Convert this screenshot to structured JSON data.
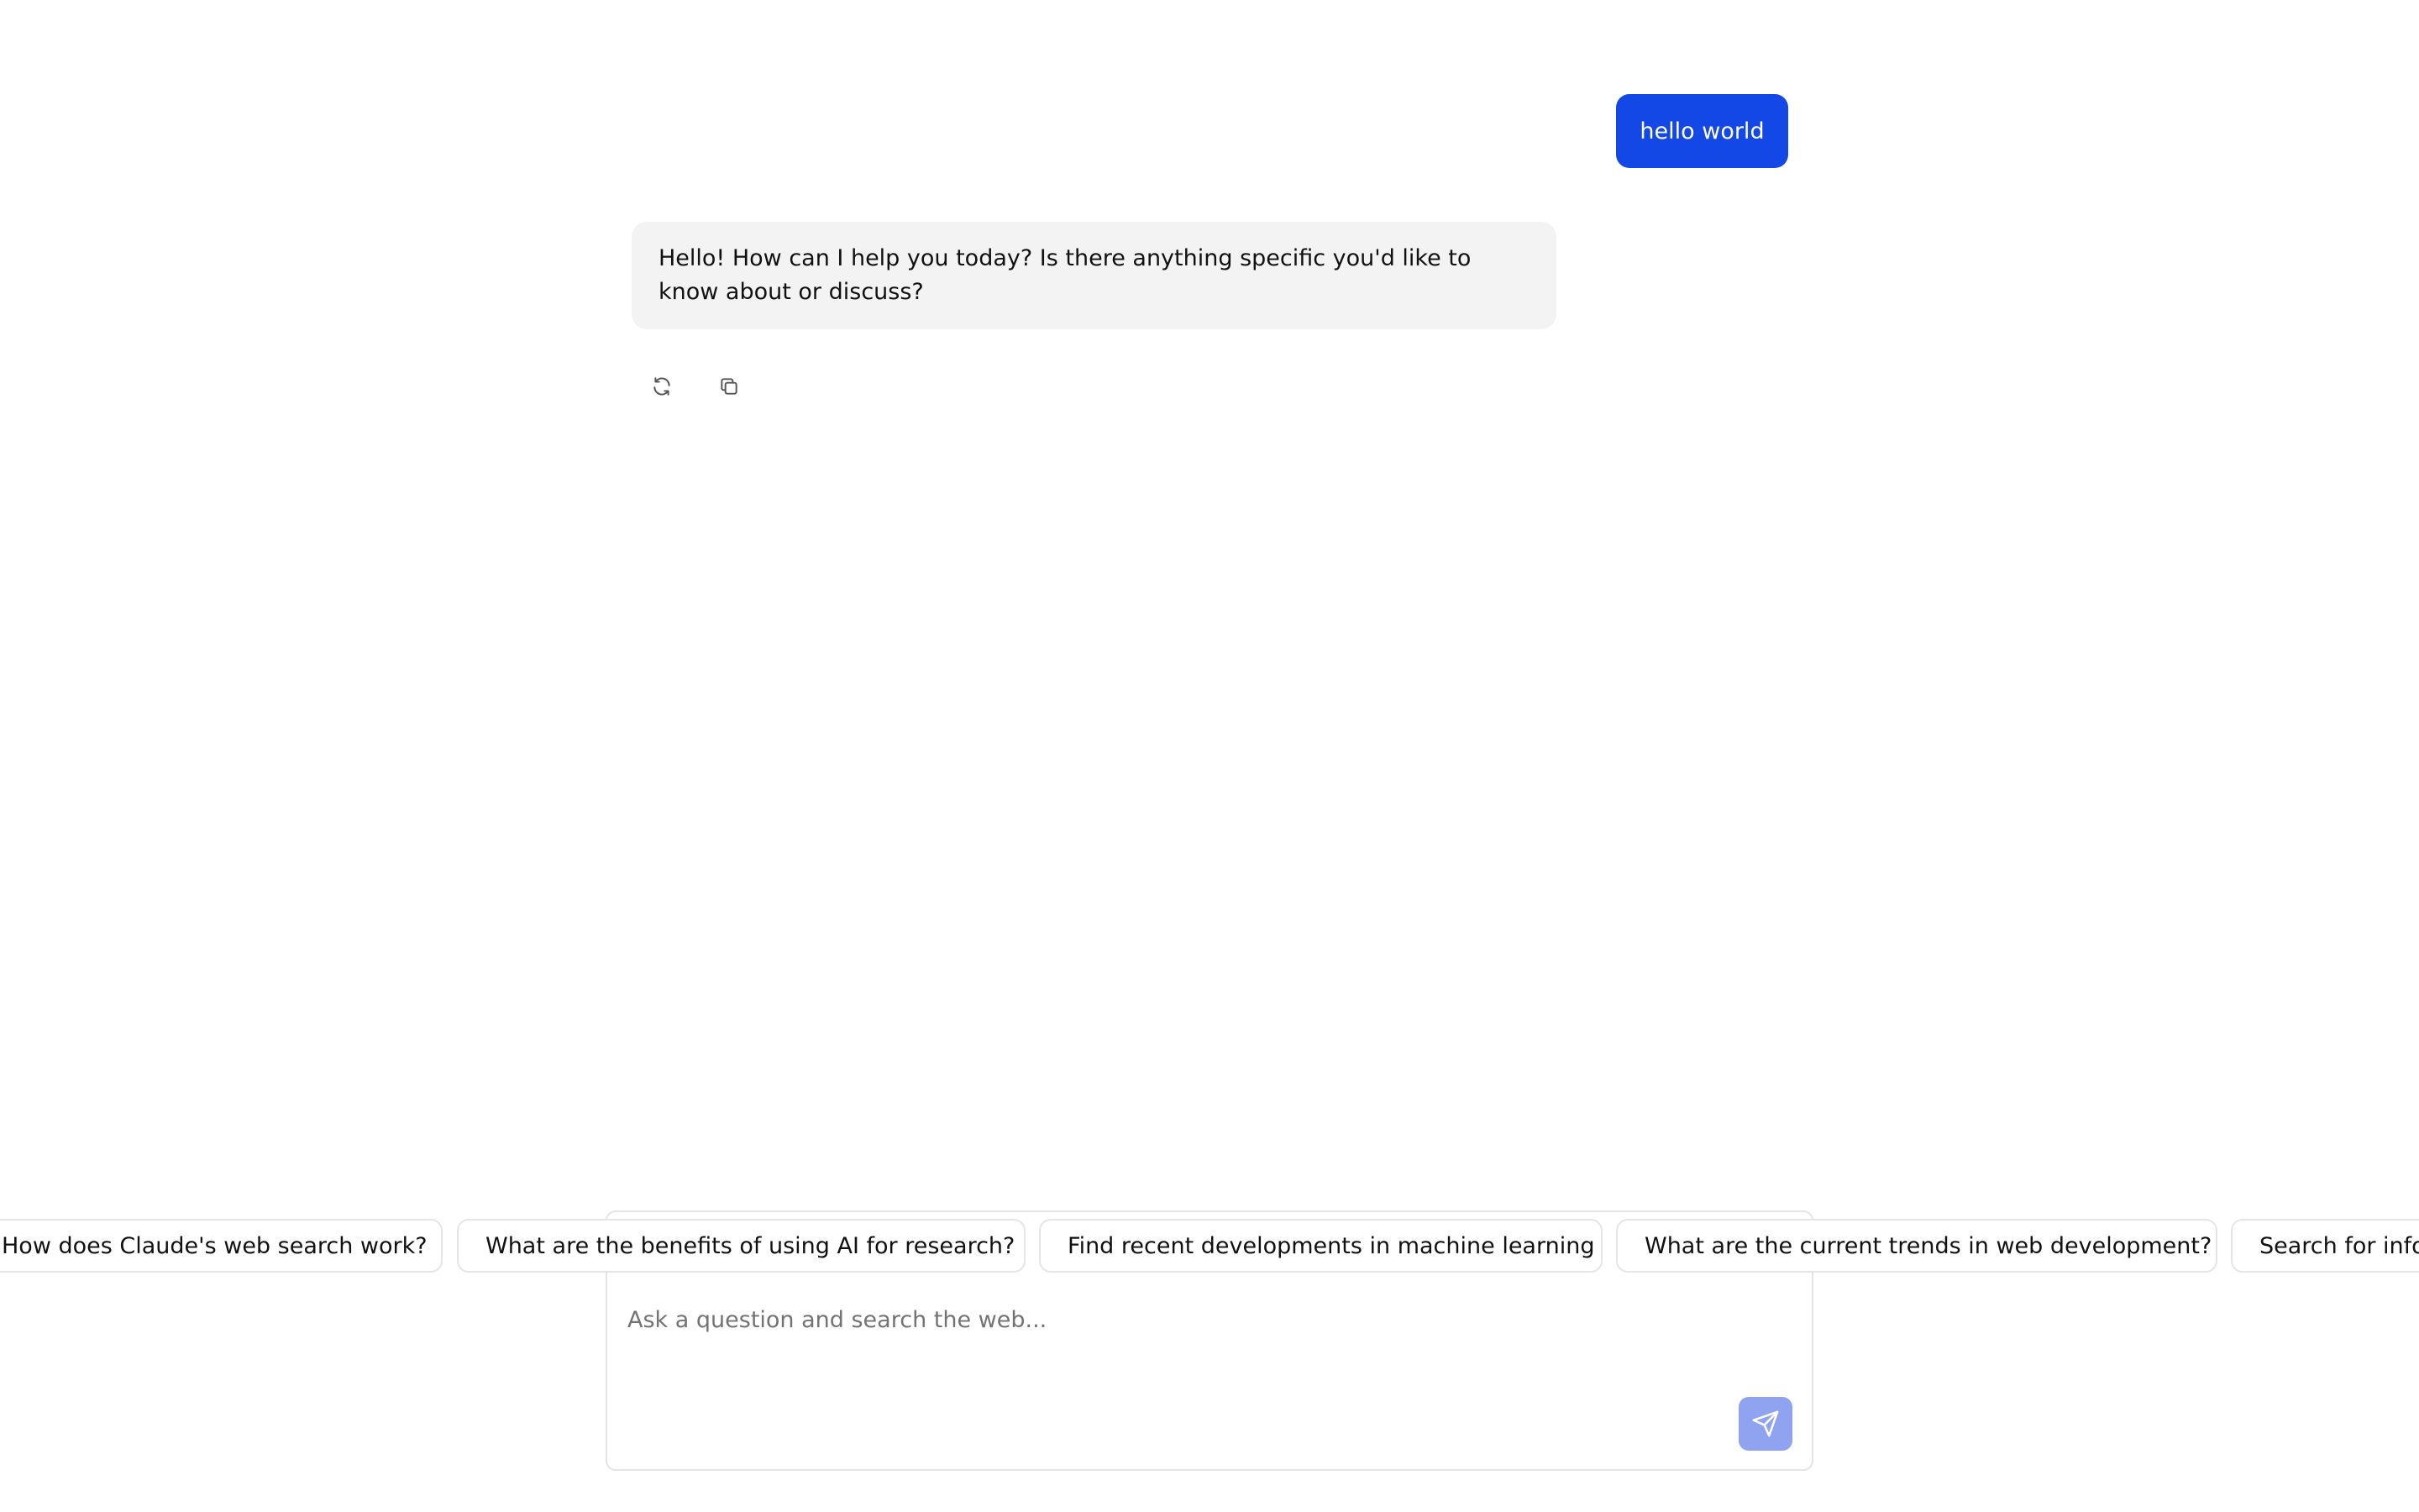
{
  "conversation": {
    "user_message": "hello world",
    "assistant_message": "Hello! How can I help you today? Is there anything specific you'd like to know about or discuss?",
    "actions": [
      {
        "icon": "refresh-icon"
      },
      {
        "icon": "copy-icon"
      }
    ]
  },
  "suggestions": [
    "How does Claude's web search work?",
    "What are the benefits of using AI for research?",
    "Find recent developments in machine learning",
    "What are the current trends in web development?",
    "Search for info"
  ],
  "composer": {
    "placeholder": "Ask a question and search the web...",
    "value": "",
    "send_icon": "send-icon"
  },
  "colors": {
    "user_bubble": "#1448e6",
    "assistant_bubble": "#f3f3f3",
    "send_button": "#8fa3f0"
  }
}
